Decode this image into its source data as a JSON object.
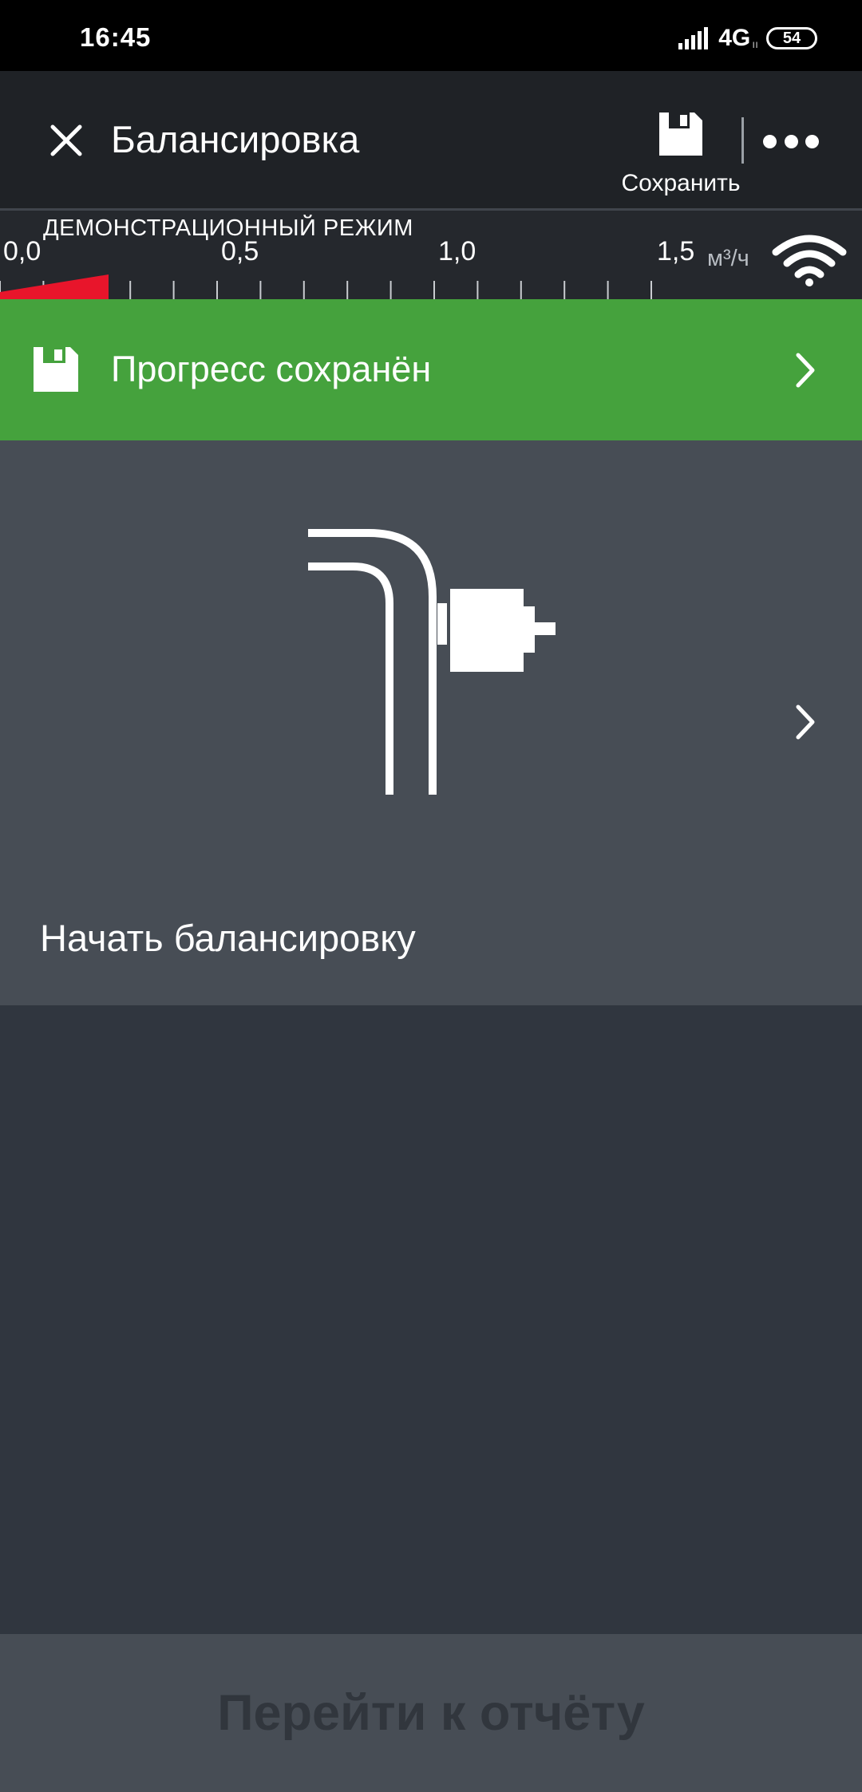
{
  "status_bar": {
    "time": "16:45",
    "network": "4G",
    "network_sub": "ıı",
    "battery": "54"
  },
  "app_bar": {
    "title": "Балансировка",
    "save_label": "Сохранить",
    "close_icon": "close-icon",
    "save_icon": "floppy-disk-icon",
    "more_icon": "more-horizontal-icon"
  },
  "scale": {
    "mode_label": "ДЕМОНСТРАЦИОННЫЙ РЕЖИМ",
    "tick_labels": [
      "0,0",
      "0,5",
      "1,0",
      "1,5"
    ],
    "unit": "м³/ч",
    "range": [
      0,
      1.5
    ],
    "current_value": 0.25,
    "indicator_color": "#e8152b"
  },
  "banner": {
    "text": "Прогресс сохранён",
    "color": "#45a23d",
    "icon": "floppy-disk-icon"
  },
  "card": {
    "label": "Начать балансировку",
    "illustration": "pipe-valve-icon"
  },
  "bottom_button": {
    "label": "Перейти к отчёту"
  }
}
